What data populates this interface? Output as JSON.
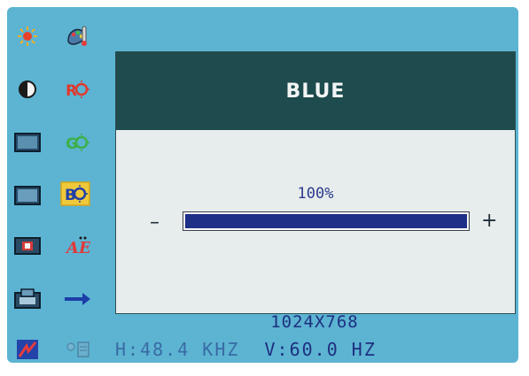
{
  "osd": {
    "title": "BLUE",
    "value_label": "100%",
    "level_percent": 100,
    "minus_label": "–",
    "plus_label": "+",
    "resolution": "1024X768",
    "h_freq": "H:48.4 KHZ",
    "v_freq": "V:60.0 HZ"
  },
  "icons": {
    "left_column": [
      "brightness-icon",
      "contrast-icon",
      "h-size-icon",
      "v-size-icon",
      "position-icon",
      "zoom-icon",
      "color-icon"
    ],
    "right_column": [
      "color-temperature-icon",
      "red-icon",
      "green-icon",
      "blue-icon",
      "language-icon",
      "exit-arrow-icon",
      "info-icon"
    ],
    "red_label": "R",
    "green_label": "G",
    "blue_label": "B",
    "language_label": "AE"
  },
  "colors": {
    "background": "#5cb4d2",
    "header": "#1e4b4d",
    "panel": "#e7ecec",
    "bar_fill": "#1d2f86",
    "text": "#1e2f80"
  }
}
